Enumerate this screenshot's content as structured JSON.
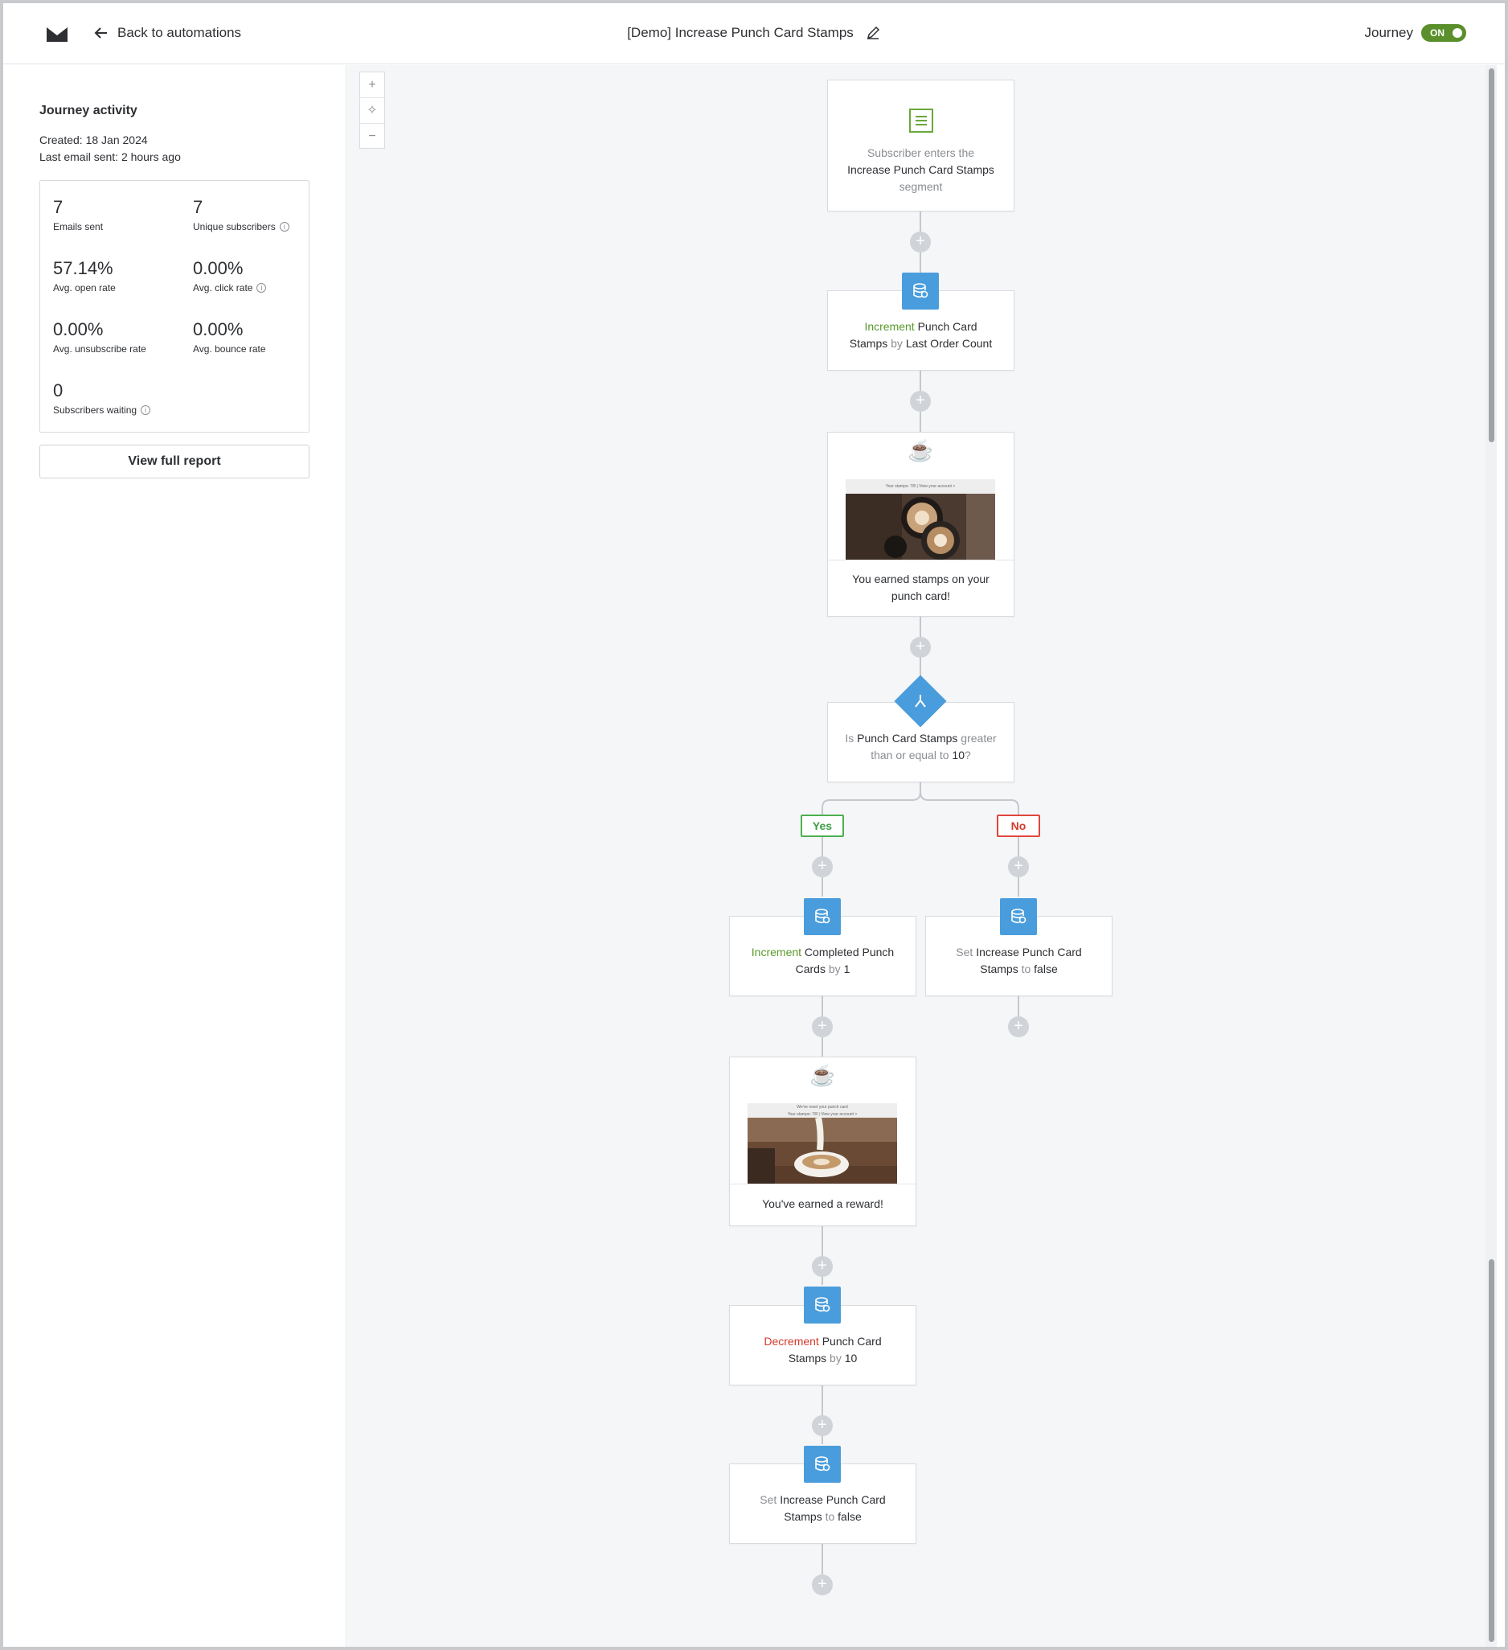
{
  "topbar": {
    "back_label": "Back to automations",
    "title": "[Demo] Increase Punch Card Stamps",
    "journey_label": "Journey",
    "toggle_label": "ON"
  },
  "activity": {
    "title": "Journey activity",
    "created": "Created: 18 Jan 2024",
    "last_email": "Last email sent: 2 hours ago",
    "stats": [
      {
        "value": "7",
        "label": "Emails sent"
      },
      {
        "value": "7",
        "label": "Unique subscribers"
      },
      {
        "value": "57.14%",
        "label": "Avg. open rate"
      },
      {
        "value": "0.00%",
        "label": "Avg. click rate"
      },
      {
        "value": "0.00%",
        "label": "Avg. unsubscribe rate"
      },
      {
        "value": "0.00%",
        "label": "Avg. bounce rate"
      },
      {
        "value": "0",
        "label": "Subscribers waiting"
      }
    ],
    "report_button": "View full report"
  },
  "zoom": {
    "in": "+",
    "fit": "✧",
    "out": "−"
  },
  "flow": {
    "trigger": {
      "pre": "Subscriber enters the",
      "segment": "Increase Punch Card Stamps",
      "post": "segment"
    },
    "step1": {
      "verb": "Increment",
      "field_a": "Punch Card",
      "field_b": "Stamps",
      "by": "by",
      "value": "Last Order Count"
    },
    "email1": {
      "subject_a": "You earned stamps on your",
      "subject_b": "punch card!",
      "header": "Your stamps: 7/8  |  View your account >"
    },
    "condition": {
      "is": "Is",
      "field": "Punch Card Stamps",
      "op_a": "greater",
      "op_b": "than or equal to",
      "value": "10",
      "q": "?"
    },
    "yes_label": "Yes",
    "no_label": "No",
    "yes_step": {
      "verb": "Increment",
      "field_a": "Completed Punch",
      "field_b": "Cards",
      "by": "by",
      "value": "1"
    },
    "no_step": {
      "verb": "Set",
      "field_a": "Increase Punch Card",
      "field_b": "Stamps",
      "to": "to",
      "value": "false"
    },
    "email2": {
      "subject": "You've earned a reward!",
      "header_a": "We've reset your punch card",
      "header_b": "Your stamps: 7/8  |  View your account >"
    },
    "step_dec": {
      "verb": "Decrement",
      "field_a": "Punch Card",
      "field_b": "Stamps",
      "by": "by",
      "value": "10"
    },
    "step_set": {
      "verb": "Set",
      "field_a": "Increase Punch Card",
      "field_b": "Stamps",
      "to": "to",
      "value": "false"
    },
    "plus": "+"
  },
  "colors": {
    "accent_blue": "#4a9ddc",
    "green": "#5a9a2a",
    "red": "#d33a2c",
    "toggle_on": "#5a8f2b"
  }
}
